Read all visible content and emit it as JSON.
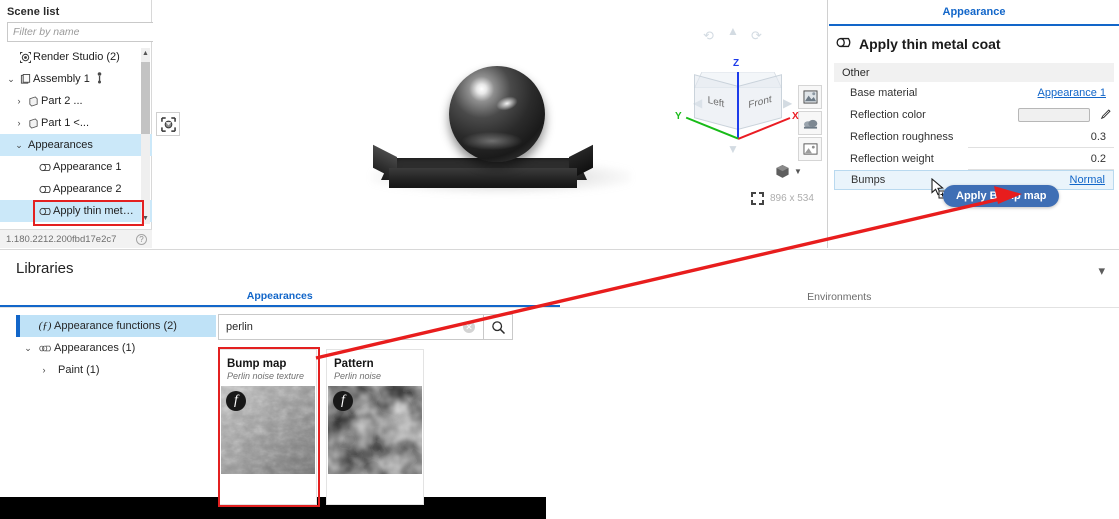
{
  "scene_panel": {
    "title": "Scene list",
    "filter_placeholder": "Filter by name",
    "list_view_icon": "list-view-icon",
    "tree": [
      {
        "label": "Render Studio (2)",
        "caret": "",
        "icon": "render-studio-icon",
        "indent": 0,
        "selected": false
      },
      {
        "label": "Assembly 1",
        "caret": "⌄",
        "icon": "assembly-icon",
        "indent": 0,
        "selected": false
      },
      {
        "label": "Part 2 ...",
        "caret": "›",
        "icon": "part-icon",
        "indent": 1,
        "selected": false
      },
      {
        "label": "Part 1 <...",
        "caret": "›",
        "icon": "part-icon",
        "indent": 1,
        "selected": false
      },
      {
        "label": "Appearances",
        "caret": "⌄",
        "icon": "",
        "indent": 1,
        "selected": true
      },
      {
        "label": "Appearance 1",
        "caret": "",
        "icon": "appearance-icon",
        "indent": 2,
        "selected": false
      },
      {
        "label": "Appearance 2",
        "caret": "",
        "icon": "appearance-icon",
        "indent": 2,
        "selected": false
      },
      {
        "label": "Apply thin metal ...",
        "caret": "",
        "icon": "appearance-icon",
        "indent": 2,
        "selected": true
      }
    ],
    "footer_version": "1.180.2212.200fbd17e2c7",
    "footer_help": "?"
  },
  "viewport": {
    "focus_icon": "focus-target-icon",
    "tool_icons": [
      "render-image-icon",
      "environment-icon",
      "background-image-icon"
    ],
    "view_cube": {
      "face_left": "Left",
      "face_front": "Front",
      "axis_x": "X",
      "axis_y": "Y",
      "axis_z": "Z"
    },
    "resolution": "896 x 534",
    "crop_icon": "crop-frame-icon"
  },
  "appearance": {
    "tab_label": "Appearance",
    "header_icon": "appearance-icon",
    "header_title": "Apply thin metal coat",
    "section_title": "Other",
    "properties": [
      {
        "label": "Base material",
        "value": "Appearance 1",
        "type": "link"
      },
      {
        "label": "Reflection color",
        "value": "",
        "type": "color",
        "edit_icon": "pencil-icon"
      },
      {
        "label": "Reflection roughness",
        "value": "0.3",
        "type": "number"
      },
      {
        "label": "Reflection weight",
        "value": "0.2",
        "type": "number"
      },
      {
        "label": "Bumps",
        "value": "Normal",
        "type": "link",
        "highlighted": true
      }
    ],
    "tooltip_button": "Apply Bump map",
    "cursor_icon": "drag-drop-cursor-icon",
    "accent_color": "#1266c9",
    "tooltip_color": "#3f6fb5"
  },
  "libraries": {
    "title": "Libraries",
    "collapse_icon": "chevron-down-icon",
    "tabs": [
      {
        "label": "Appearances",
        "active": true
      },
      {
        "label": "Environments",
        "active": false
      }
    ],
    "tree": [
      {
        "label": "Appearance functions (2)",
        "caret": "",
        "icon": "function-icon",
        "indent": 0,
        "selected": true
      },
      {
        "label": "Appearances (1)",
        "caret": "⌄",
        "icon": "appearances-group-icon",
        "indent": 0,
        "selected": false
      },
      {
        "label": "Paint (1)",
        "caret": "›",
        "icon": "",
        "indent": 1,
        "selected": false
      }
    ],
    "search": {
      "value": "perlin",
      "placeholder": "Search",
      "clear_icon": "clear-circle-icon",
      "search_icon": "search-icon"
    },
    "cards": [
      {
        "name": "Bump map",
        "desc": "Perlin noise texture",
        "badge": "f",
        "thumb": "perlin-bump-thumbnail",
        "selected": true
      },
      {
        "name": "Pattern",
        "desc": "Perlin noise",
        "badge": "f",
        "thumb": "perlin-pattern-thumbnail",
        "selected": false
      }
    ]
  },
  "annotation": {
    "highlight_color": "#e32020",
    "arrow": "red-drag-arrow"
  }
}
